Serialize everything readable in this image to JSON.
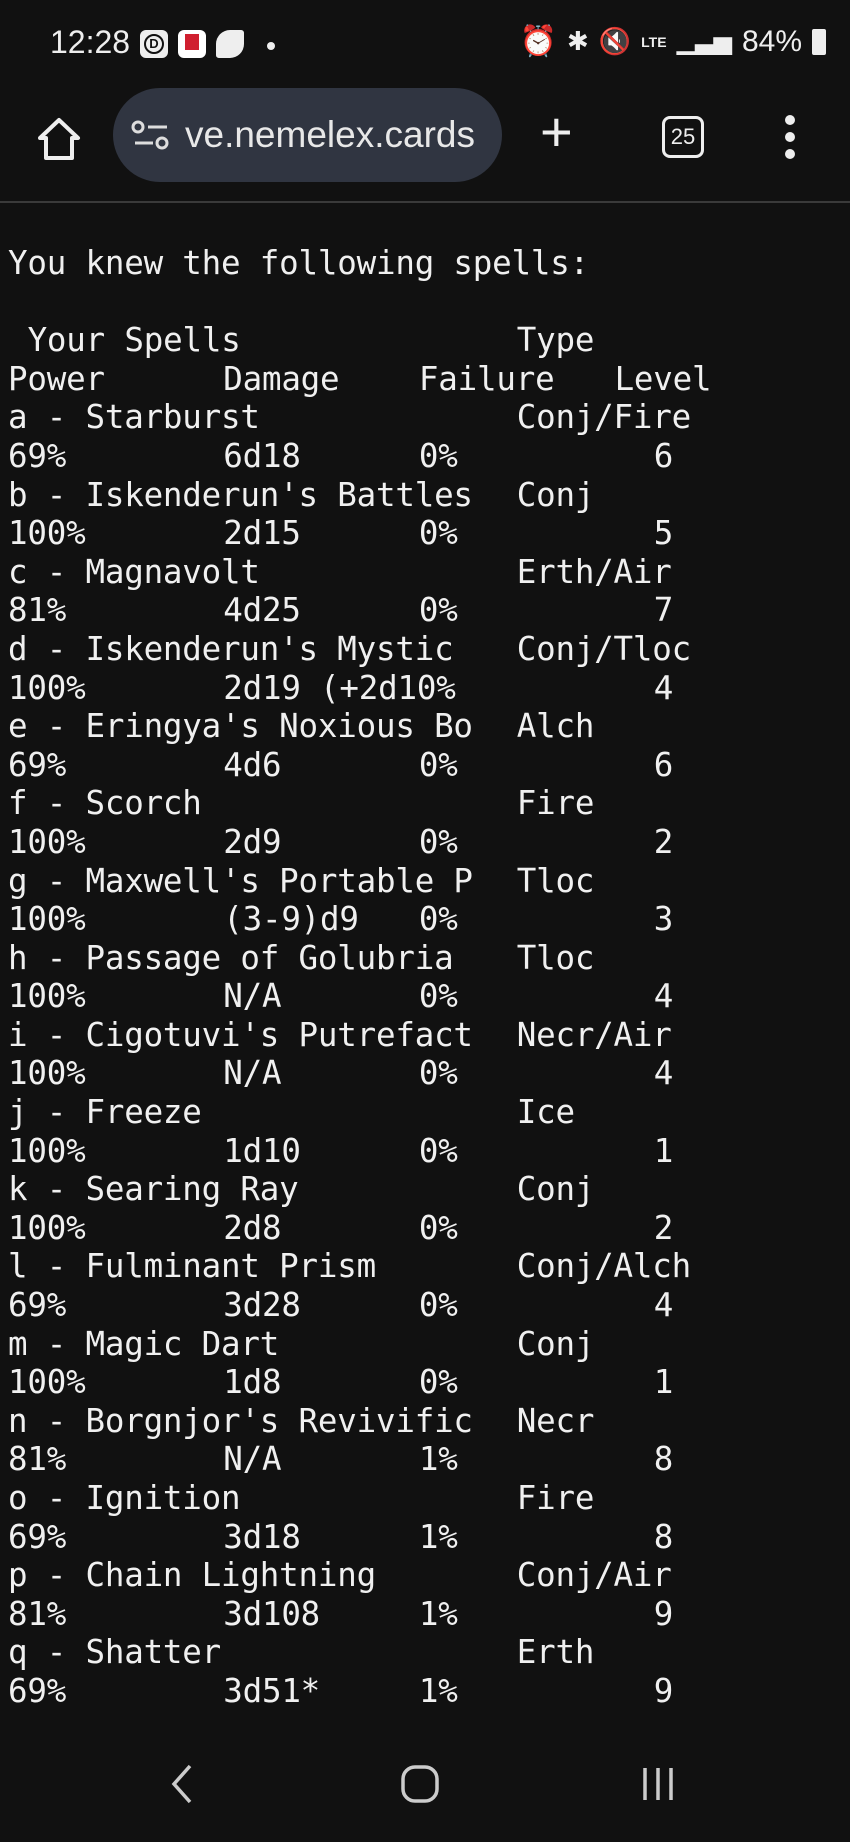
{
  "status_bar": {
    "time": "12:28",
    "battery": "84%",
    "network": "LTE",
    "icons": [
      "d-app-icon",
      "kfc-app-icon",
      "swirl-icon",
      "dot-icon",
      "alarm-icon",
      "bluetooth-icon",
      "mute-icon",
      "signal-icon",
      "battery-icon"
    ]
  },
  "browser": {
    "url": "ve.nemelex.cards",
    "tab_count": "25"
  },
  "page": {
    "intro": "You knew the following spells:",
    "header1": {
      "name": "Your Spells",
      "type": "Type"
    },
    "header2": {
      "power": "Power",
      "damage": "Damage",
      "failure": "Failure",
      "level": "Level"
    },
    "spells": [
      {
        "name": "a - Starburst",
        "type": "Conj/Fire",
        "power": "69%",
        "damage": "6d18",
        "failure": "0%",
        "level": "6"
      },
      {
        "name": "b - Iskenderun's Battles",
        "type": "Conj",
        "power": "100%",
        "damage": "2d15",
        "failure": "0%",
        "level": "5"
      },
      {
        "name": "c - Magnavolt",
        "type": "Erth/Air",
        "power": "81%",
        "damage": "4d25",
        "failure": "0%",
        "level": "7"
      },
      {
        "name": "d - Iskenderun's Mystic",
        "type": "Conj/Tloc",
        "power": "100%",
        "damage": "2d19 (+2d10%",
        "failure": "",
        "level": "4"
      },
      {
        "name": "e - Eringya's Noxious Bo",
        "type": "Alch",
        "power": "69%",
        "damage": "4d6",
        "failure": "0%",
        "level": "6"
      },
      {
        "name": "f - Scorch",
        "type": "Fire",
        "power": "100%",
        "damage": "2d9",
        "failure": "0%",
        "level": "2"
      },
      {
        "name": "g - Maxwell's Portable P",
        "type": "Tloc",
        "power": "100%",
        "damage": "(3-9)d9",
        "failure": "0%",
        "level": "3"
      },
      {
        "name": "h - Passage of Golubria",
        "type": "Tloc",
        "power": "100%",
        "damage": "N/A",
        "failure": "0%",
        "level": "4"
      },
      {
        "name": "i - Cigotuvi's Putrefact",
        "type": "Necr/Air",
        "power": "100%",
        "damage": "N/A",
        "failure": "0%",
        "level": "4"
      },
      {
        "name": "j - Freeze",
        "type": "Ice",
        "power": "100%",
        "damage": "1d10",
        "failure": "0%",
        "level": "1"
      },
      {
        "name": "k - Searing Ray",
        "type": "Conj",
        "power": "100%",
        "damage": "2d8",
        "failure": "0%",
        "level": "2"
      },
      {
        "name": "l - Fulminant Prism",
        "type": "Conj/Alch",
        "power": "69%",
        "damage": "3d28",
        "failure": "0%",
        "level": "4"
      },
      {
        "name": "m - Magic Dart",
        "type": "Conj",
        "power": "100%",
        "damage": "1d8",
        "failure": "0%",
        "level": "1"
      },
      {
        "name": "n - Borgnjor's Revivific",
        "type": "Necr",
        "power": "81%",
        "damage": "N/A",
        "failure": "1%",
        "level": "8"
      },
      {
        "name": "o - Ignition",
        "type": "Fire",
        "power": "69%",
        "damage": "3d18",
        "failure": "1%",
        "level": "8"
      },
      {
        "name": "p - Chain Lightning",
        "type": "Conj/Air",
        "power": "81%",
        "damage": "3d108",
        "failure": "1%",
        "level": "9"
      },
      {
        "name": "q - Shatter",
        "type": "Erth",
        "power": "69%",
        "damage": "3d51*",
        "failure": "1%",
        "level": "9"
      }
    ]
  }
}
